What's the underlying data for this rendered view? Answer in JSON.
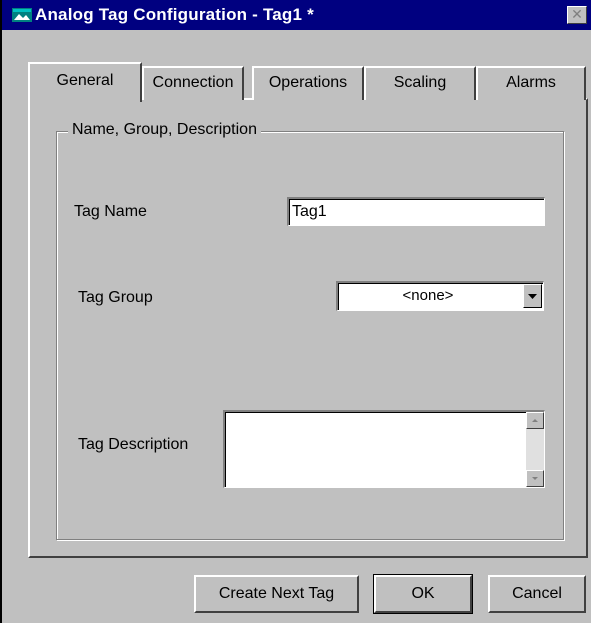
{
  "window": {
    "title": "Analog Tag Configuration - Tag1 *",
    "close_glyph": "✕",
    "icon": "app-window-icon"
  },
  "tabs": [
    {
      "label": "General",
      "active": true
    },
    {
      "label": "Connection",
      "active": false
    },
    {
      "label": "Operations",
      "active": false
    },
    {
      "label": "Scaling",
      "active": false
    },
    {
      "label": "Alarms",
      "active": false
    }
  ],
  "group": {
    "label": "Name, Group, Description"
  },
  "fields": {
    "tag_name_label": "Tag Name",
    "tag_name_value": "Tag1",
    "tag_group_label": "Tag Group",
    "tag_group_value": "<none>",
    "tag_description_label": "Tag Description",
    "tag_description_value": ""
  },
  "buttons": {
    "create_next": "Create Next Tag",
    "ok": "OK",
    "cancel": "Cancel"
  },
  "colors": {
    "titlebar": "#000080",
    "face": "#c0c0c0"
  }
}
